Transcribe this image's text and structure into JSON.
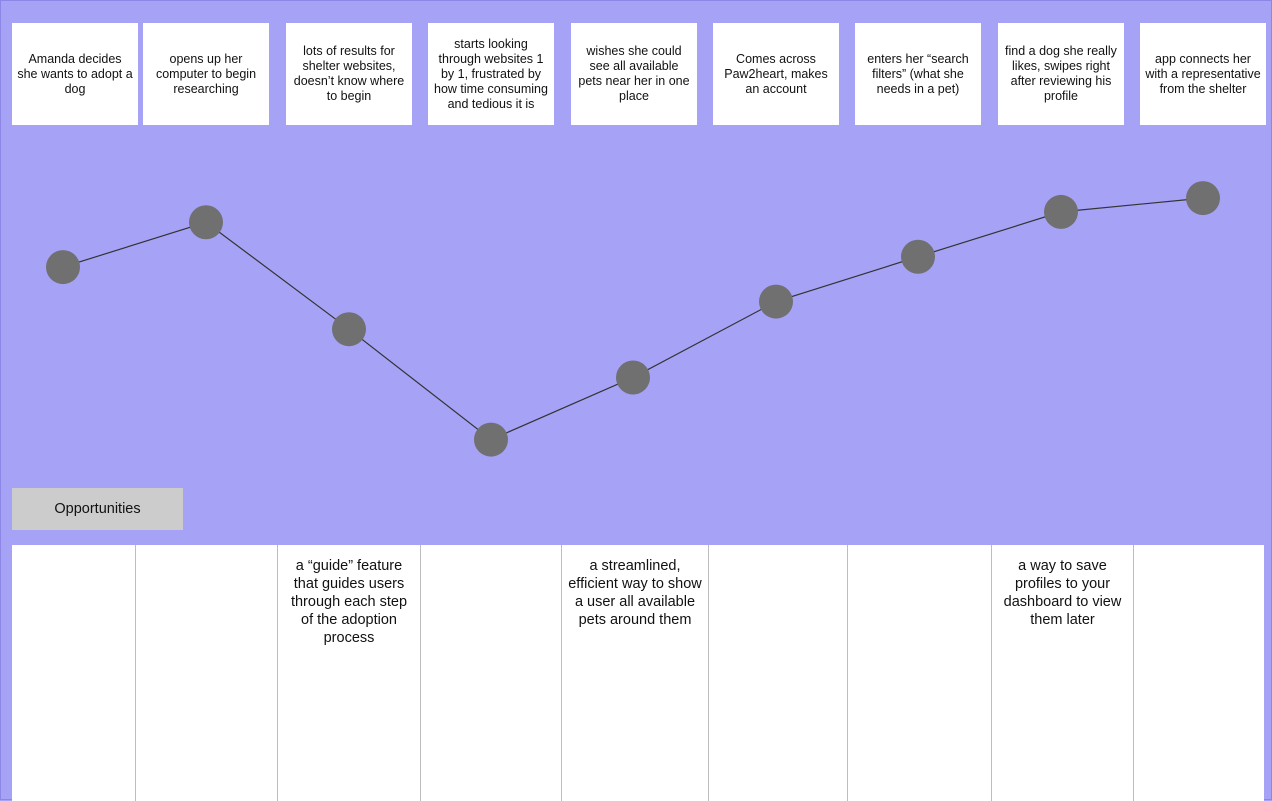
{
  "journey": {
    "steps": [
      {
        "label": "Amanda decides she wants to adopt a dog",
        "sentiment": 0.62
      },
      {
        "label": "opens up her computer to begin researching",
        "sentiment": 0.75
      },
      {
        "label": "lots of results for shelter websites, doesn’t know where to begin",
        "sentiment": 0.44
      },
      {
        "label": "starts looking through websites 1 by 1, frustrated by how time consuming and tedious it is",
        "sentiment": 0.12
      },
      {
        "label": "wishes she could see all available pets near her in one place",
        "sentiment": 0.3
      },
      {
        "label": "Comes across Paw2heart, makes an account",
        "sentiment": 0.52
      },
      {
        "label": "enters her “search filters” (what she needs in a pet)",
        "sentiment": 0.65
      },
      {
        "label": "find a dog she really likes, swipes right after reviewing his profile",
        "sentiment": 0.78
      },
      {
        "label": "app connects her with a representative from the shelter",
        "sentiment": 0.82
      }
    ]
  },
  "opportunities": {
    "title": "Opportunities",
    "cells": [
      "",
      "",
      "a “guide” feature that guides users through each step of the adoption process",
      "",
      "a streamlined, efficient way to show a user all available pets around them",
      "",
      "",
      "a way to save profiles to your dashboard to view them later",
      ""
    ]
  },
  "colors": {
    "background": "#a6a2f6",
    "card": "#ffffff",
    "point": "#707070",
    "line": "#333333",
    "label_box": "#cccccc"
  }
}
